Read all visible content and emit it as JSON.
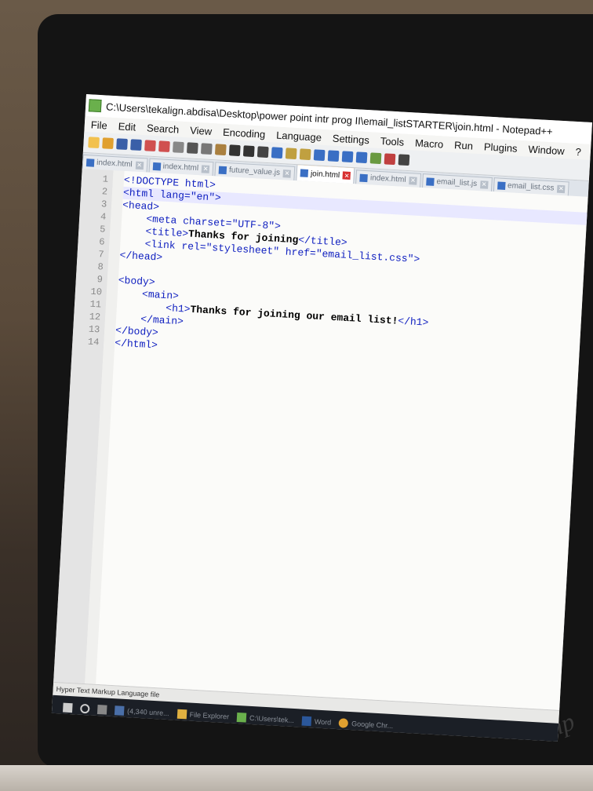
{
  "window": {
    "title": "C:\\Users\\tekalign.abdisa\\Desktop\\power point intr prog II\\email_listSTARTER\\join.html - Notepad++"
  },
  "menu": [
    "File",
    "Edit",
    "Search",
    "View",
    "Encoding",
    "Language",
    "Settings",
    "Tools",
    "Macro",
    "Run",
    "Plugins",
    "Window",
    "?"
  ],
  "tabs": [
    {
      "label": "index.html",
      "active": false
    },
    {
      "label": "index.html",
      "active": false
    },
    {
      "label": "future_value.js",
      "active": false
    },
    {
      "label": "join.html",
      "active": true
    },
    {
      "label": "index.html",
      "active": false
    },
    {
      "label": "email_list.js",
      "active": false
    },
    {
      "label": "email_list.css",
      "active": false
    }
  ],
  "editor": {
    "line_numbers": [
      "1",
      "2",
      "3",
      "4",
      "5",
      "6",
      "7",
      "8",
      "9",
      "10",
      "11",
      "12",
      "13",
      "14"
    ],
    "lines": [
      "<!DOCTYPE html>",
      "<html lang=\"en\">",
      "<head>",
      "    <meta charset=\"UTF-8\">",
      "    <title>Thanks for joining</title>",
      "    <link rel=\"stylesheet\" href=\"email_list.css\">",
      "</head>",
      "",
      "<body>",
      "    <main>",
      "        <h1>Thanks for joining our email list!</h1>",
      "    </main>",
      "</body>",
      "</html>"
    ]
  },
  "status": {
    "file_type": "Hyper Text Markup Language file"
  },
  "taskbar": {
    "items": [
      "(4,340 unre...",
      "File Explorer",
      "C:\\Users\\tek...",
      "Word",
      "Google Chr..."
    ]
  },
  "colors": {
    "tag": "#1020c0",
    "attr": "#e02020",
    "value": "#7a1fa2",
    "active_tab_accent": "#f0a030"
  }
}
